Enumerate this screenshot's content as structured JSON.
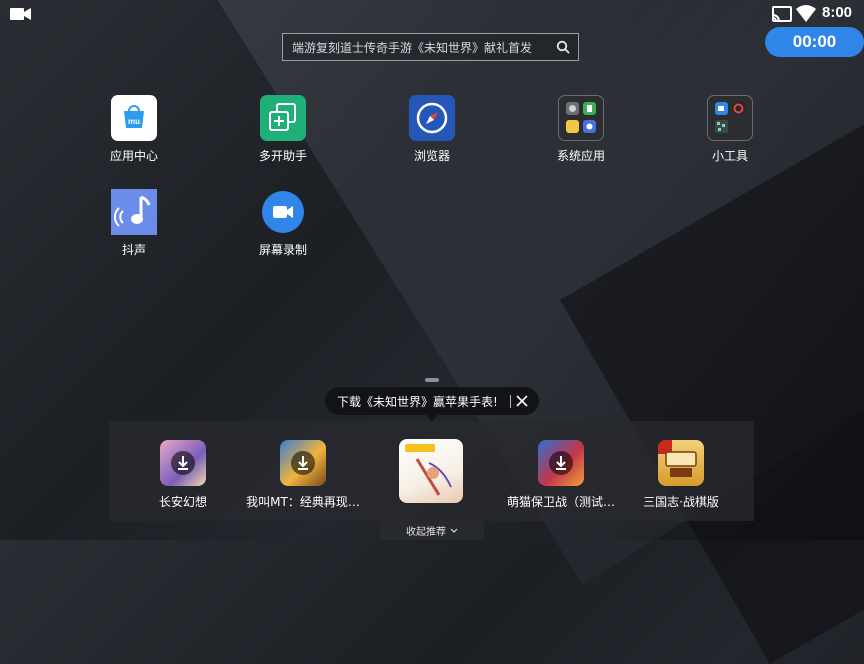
{
  "status_bar": {
    "time": "8:00"
  },
  "record_timer": {
    "label": "00:00"
  },
  "search": {
    "text": "端游复刻道士传奇手游《未知世界》献礼首发"
  },
  "apps": [
    {
      "label": "应用中心",
      "icon": "app-store-icon",
      "color": "#ffffff"
    },
    {
      "label": "多开助手",
      "icon": "multi-open-icon",
      "color": "#1fb07a"
    },
    {
      "label": "浏览器",
      "icon": "compass-icon",
      "color": "#2457b8"
    },
    {
      "label": "系统应用",
      "icon": "folder-icon",
      "color": "#2b2d31"
    },
    {
      "label": "小工具",
      "icon": "folder-icon",
      "color": "#2b2d31"
    },
    {
      "label": "抖声",
      "icon": "music-icon",
      "color": "#6b8ce8"
    },
    {
      "label": "屏幕录制",
      "icon": "video-camera-icon",
      "color": "#2f86e8"
    }
  ],
  "tooltip": {
    "text": "下载《未知世界》赢苹果手表!"
  },
  "dock": {
    "apps": [
      {
        "label": "长安幻想",
        "icon": "download-icon"
      },
      {
        "label": "我叫MT：经典再现…",
        "icon": "download-icon"
      },
      {
        "label": "",
        "icon": "featured-game-icon"
      },
      {
        "label": "萌猫保卫战（测试…",
        "icon": "download-icon"
      },
      {
        "label": "三国志·战棋版",
        "icon": "game-icon"
      }
    ],
    "collapse_label": "收起推荐"
  },
  "colors": {
    "accent": "#2f86e8"
  }
}
